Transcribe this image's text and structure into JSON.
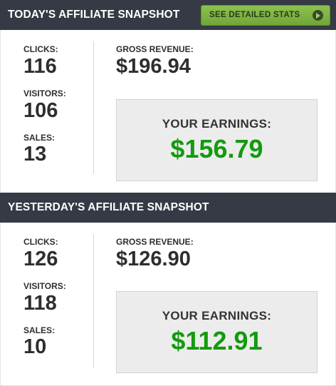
{
  "today": {
    "title": "TODAY'S AFFILIATE SNAPSHOT",
    "stats_button_label": "SEE DETAILED STATS",
    "clicks_label": "CLICKS:",
    "clicks_value": "116",
    "visitors_label": "VISITORS:",
    "visitors_value": "106",
    "sales_label": "SALES:",
    "sales_value": "13",
    "gross_label": "GROSS REVENUE:",
    "gross_value": "$196.94",
    "earnings_label": "YOUR EARNINGS:",
    "earnings_value": "$156.79"
  },
  "yesterday": {
    "title": "YESTERDAY'S AFFILIATE SNAPSHOT",
    "clicks_label": "CLICKS:",
    "clicks_value": "126",
    "visitors_label": "VISITORS:",
    "visitors_value": "118",
    "sales_label": "SALES:",
    "sales_value": "10",
    "gross_label": "GROSS REVENUE:",
    "gross_value": "$126.90",
    "earnings_label": "YOUR EARNINGS:",
    "earnings_value": "$112.91"
  },
  "icons": {
    "stats_button_icon": "play-circle-icon"
  },
  "colors": {
    "header_bg": "#353a44",
    "button_green": "#7cb342",
    "earnings_green": "#139a0f",
    "earnings_box_bg": "#ececec"
  }
}
